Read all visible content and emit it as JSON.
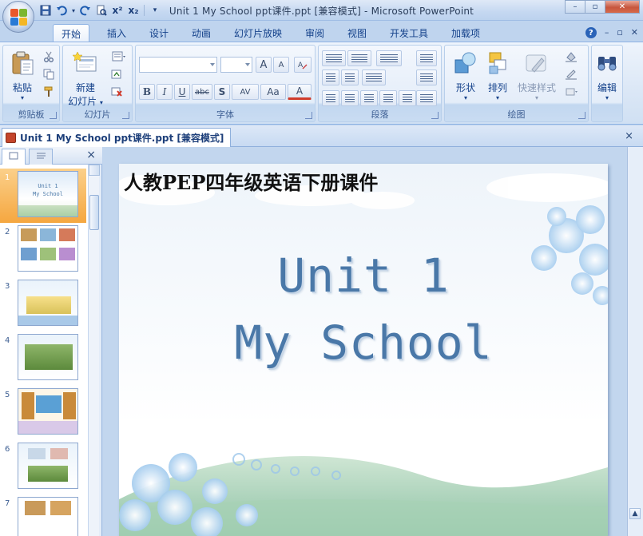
{
  "window": {
    "title": "Unit 1 My School ppt课件.ppt [兼容模式] - Microsoft PowerPoint",
    "minimize": "–",
    "maximize": "▫",
    "close": "✕"
  },
  "quick_access": {
    "save_icon": "save-icon",
    "undo_icon": "undo-icon",
    "redo_icon": "redo-icon",
    "preview_icon": "print-preview-icon",
    "superscript": "x²",
    "subscript": "x₂",
    "customize": "▾"
  },
  "ribbon_tabs": [
    "开始",
    "插入",
    "设计",
    "动画",
    "幻灯片放映",
    "审阅",
    "视图",
    "开发工具",
    "加载项"
  ],
  "ribbon_right": {
    "help": "?",
    "min": "–",
    "restore": "▫",
    "close": "✕"
  },
  "groups": {
    "clipboard": {
      "label": "剪贴板",
      "paste": "粘贴"
    },
    "slides": {
      "label": "幻灯片",
      "new_slide": "新建",
      "new_slide_line2": "幻灯片"
    },
    "font": {
      "label": "字体",
      "bold": "B",
      "italic": "I",
      "underline": "U",
      "strike": "abc",
      "shadow": "S",
      "spacing": "AV",
      "case": "Aa",
      "color": "A",
      "grow": "A",
      "shrink": "A"
    },
    "paragraph": {
      "label": "段落"
    },
    "drawing": {
      "label": "绘图",
      "shapes": "形状",
      "arrange": "排列",
      "quick_styles": "快速样式"
    },
    "editing": {
      "label": "",
      "edit": "编辑"
    }
  },
  "document_tab": {
    "title": "Unit 1 My School ppt课件.ppt [兼容模式]",
    "close": "×"
  },
  "pane": {
    "close": "×"
  },
  "thumbnails": [
    {
      "num": "1",
      "line1": "Unit 1",
      "line2": "My School"
    },
    {
      "num": "2"
    },
    {
      "num": "3"
    },
    {
      "num": "4"
    },
    {
      "num": "5"
    },
    {
      "num": "6"
    },
    {
      "num": "7"
    }
  ],
  "slide": {
    "pretitle": "人教PEP四年级英语下册课件",
    "title_line1": "Unit 1",
    "title_line2": "My School"
  },
  "colors": {
    "accent": "#15428b",
    "ribbon_bg": "#dbe7f6",
    "selected_thumb": "#f5a740",
    "slide_title": "#4a78a8"
  }
}
